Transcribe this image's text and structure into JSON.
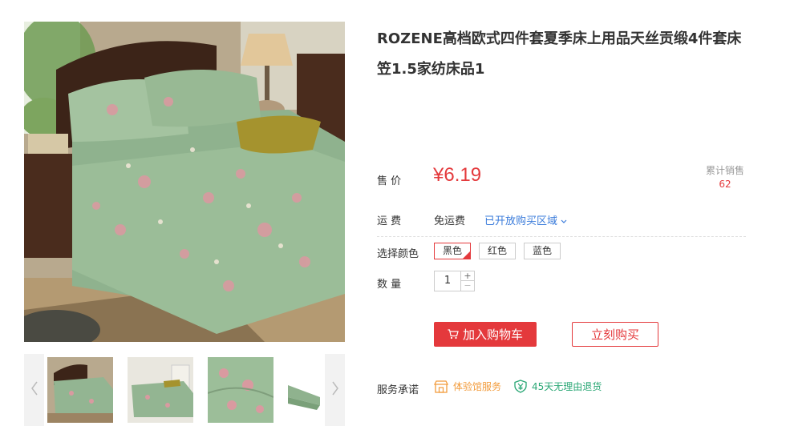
{
  "product": {
    "title_line1": "ROZENE高档欧式四件套夏季床上用品天丝贡缎4件套床",
    "title_line2": "笠1.5家纺床品1"
  },
  "price": {
    "label": "售 价",
    "value": "¥6.19"
  },
  "sales": {
    "label": "累计销售",
    "count": "62"
  },
  "shipping": {
    "label": "运 费",
    "value": "免运费",
    "region_link": "已开放购买区域"
  },
  "color": {
    "label": "选择颜色",
    "options": [
      "黑色",
      "红色",
      "蓝色"
    ],
    "selected": "黑色"
  },
  "quantity": {
    "label": "数 量",
    "value": "1",
    "plus": "+",
    "minus": "−"
  },
  "actions": {
    "add_to_cart": "加入购物车",
    "buy_now": "立刻购买"
  },
  "services": {
    "label": "服务承诺",
    "items": [
      {
        "icon": "store-icon",
        "text": "体验馆服务"
      },
      {
        "icon": "yen-shield-icon",
        "text": "45天无理由退货"
      }
    ]
  },
  "colors": {
    "accent": "#e4393c",
    "link": "#3b7cdb",
    "service_orange": "#f29b3b",
    "service_green": "#2aa775",
    "bedding_green": "#8fb28e"
  },
  "icons": [
    "chevron-left-icon",
    "chevron-right-icon",
    "chevron-down-icon",
    "cart-icon",
    "store-icon",
    "yen-shield-icon"
  ]
}
